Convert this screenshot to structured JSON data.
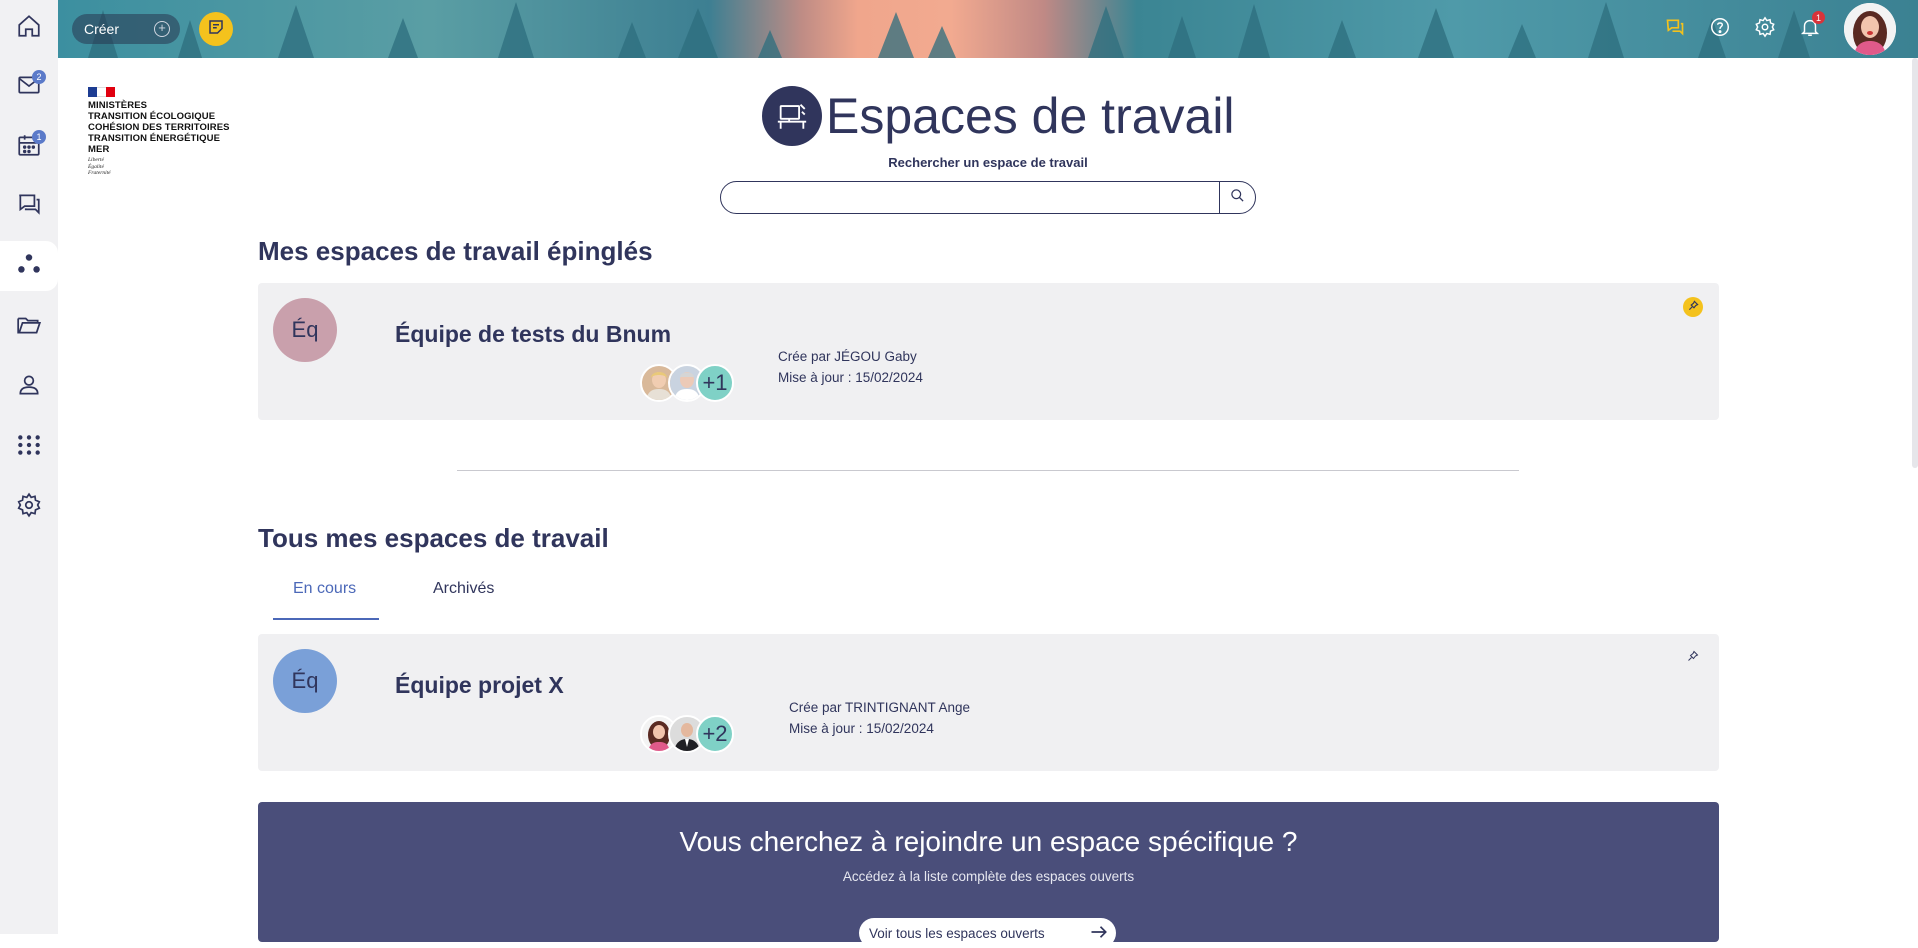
{
  "header": {
    "create_label": "Créer",
    "notification_count": "1"
  },
  "sidebar": {
    "items": [
      {
        "name": "home",
        "icon": "home-icon"
      },
      {
        "name": "mail",
        "icon": "mail-icon",
        "badge": "2"
      },
      {
        "name": "calendar",
        "icon": "calendar-icon",
        "badge": "1"
      },
      {
        "name": "chat",
        "icon": "chat-icon"
      },
      {
        "name": "workspaces",
        "icon": "workspaces-icon",
        "active": true
      },
      {
        "name": "files",
        "icon": "folder-icon"
      },
      {
        "name": "contacts",
        "icon": "user-icon"
      },
      {
        "name": "apps",
        "icon": "apps-grid-icon"
      },
      {
        "name": "settings",
        "icon": "gear-icon"
      }
    ]
  },
  "logo": {
    "lines": [
      "MINISTÈRES",
      "TRANSITION ÉCOLOGIQUE",
      "COHÉSION DES TERRITOIRES",
      "TRANSITION ÉNERGÉTIQUE",
      "MER"
    ],
    "motto": [
      "Liberté",
      "Égalité",
      "Fraternité"
    ]
  },
  "page": {
    "title": "Espaces de travail",
    "search_label": "Rechercher un espace de travail",
    "search_placeholder": ""
  },
  "pinned": {
    "heading": "Mes espaces de travail épinglés",
    "cards": [
      {
        "initials": "Éq",
        "name": "Équipe de tests du Bnum",
        "member_extra": "+1",
        "created_by": "Crée par JÉGOU Gaby",
        "updated": "Mise à jour : 15/02/2024"
      }
    ]
  },
  "all": {
    "heading": "Tous mes espaces de travail",
    "tabs": [
      {
        "label": "En cours",
        "active": true
      },
      {
        "label": "Archivés",
        "active": false
      }
    ],
    "cards": [
      {
        "initials": "Éq",
        "name": "Équipe projet X",
        "member_extra": "+2",
        "created_by": "Crée par TRINTIGNANT Ange",
        "updated": "Mise à jour : 15/02/2024"
      }
    ]
  },
  "join": {
    "title": "Vous cherchez à rejoindre un espace spécifique ?",
    "subtitle": "Accédez à la liste complète des espaces ouverts",
    "button_label": "Voir tous les espaces ouverts"
  },
  "colors": {
    "primary": "#30355c",
    "accent_yellow": "#f4c21d",
    "tab_active": "#4b68b8",
    "pinned_avatar_bg": "#c9a0ac",
    "project_avatar_bg": "#7aa0d8",
    "banner_bg": "#4a4e7a"
  }
}
